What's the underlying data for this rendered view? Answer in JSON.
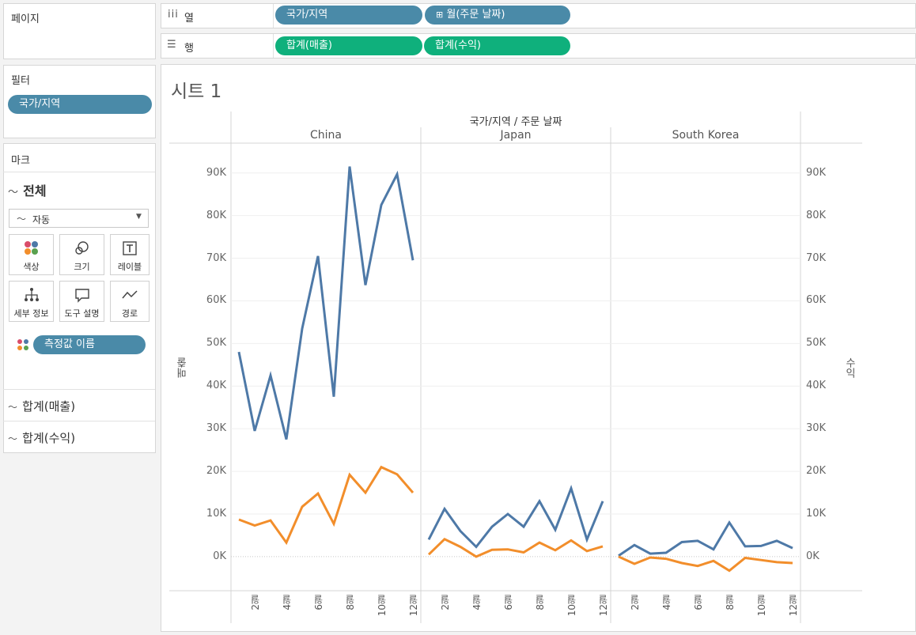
{
  "pages_panel": {
    "title": "페이지"
  },
  "filters_panel": {
    "title": "필터",
    "pill": "국가/지역"
  },
  "marks_panel": {
    "title": "마크",
    "all_label": "전체",
    "type_dropdown": "자동",
    "buttons": [
      "색상",
      "크기",
      "레이블",
      "세부 정보",
      "도구 설명",
      "경로"
    ],
    "measure_names_pill": "측정값 이름",
    "sections": [
      "합계(매출)",
      "합계(수익)"
    ]
  },
  "shelves": {
    "columns": {
      "label": "열",
      "pills": [
        "국가/지역",
        "월(주문 날짜)"
      ]
    },
    "rows": {
      "label": "행",
      "pills": [
        "합계(매출)",
        "합계(수익)"
      ]
    }
  },
  "sheet": {
    "title": "시트 1"
  },
  "chart_data": {
    "type": "line",
    "header": "국가/지역 / 주문 날짜",
    "panels": [
      "China",
      "Japan",
      "South Korea"
    ],
    "x_ticks": [
      "2월",
      "4월",
      "6월",
      "8월",
      "10월",
      "12월"
    ],
    "months": [
      1,
      2,
      3,
      4,
      5,
      6,
      7,
      8,
      9,
      10,
      11,
      12
    ],
    "y_left_label": "매출",
    "y_right_label": "수익",
    "y_ticks": [
      "0K",
      "10K",
      "20K",
      "30K",
      "40K",
      "50K",
      "60K",
      "70K",
      "80K",
      "90K"
    ],
    "ylim": [
      -8000,
      97000
    ],
    "colors": {
      "sales": "#4e79a7",
      "profit": "#f28e2b"
    },
    "series": [
      {
        "measure": "매출",
        "panels": [
          [
            48000,
            29500,
            42500,
            27500,
            53500,
            70500,
            37500,
            91500,
            63700,
            82500,
            89700,
            69500
          ],
          [
            4000,
            11200,
            6000,
            2300,
            7000,
            10000,
            7000,
            13000,
            6300,
            16000,
            4000,
            13000
          ],
          [
            200,
            2700,
            700,
            900,
            3400,
            3700,
            1700,
            8000,
            2400,
            2500,
            3700,
            2000
          ]
        ]
      },
      {
        "measure": "수익",
        "panels": [
          [
            8700,
            7300,
            8500,
            3300,
            11700,
            14800,
            7700,
            19200,
            15000,
            21000,
            19300,
            15000
          ],
          [
            500,
            4100,
            2300,
            0,
            1600,
            1700,
            1000,
            3300,
            1500,
            3800,
            1300,
            2400
          ],
          [
            0,
            -1700,
            -200,
            -500,
            -1500,
            -2200,
            -1000,
            -3300,
            -300,
            -800,
            -1300,
            -1500
          ]
        ]
      }
    ]
  }
}
